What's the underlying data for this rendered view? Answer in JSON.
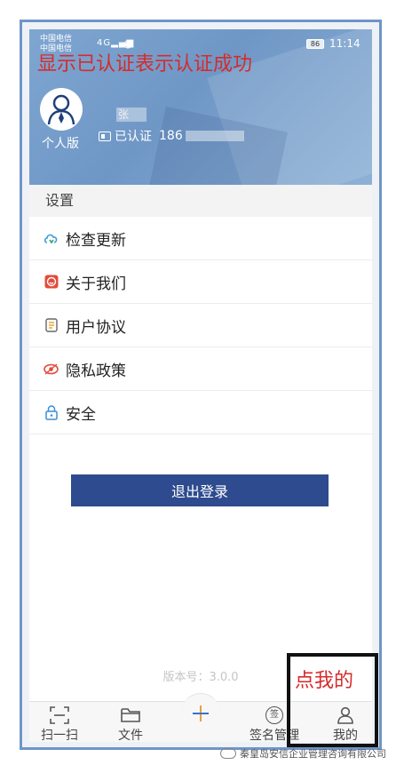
{
  "status_bar": {
    "carrier_1": "中国电信",
    "carrier_2": "中国电信",
    "network": "4G",
    "battery": "86",
    "time": "11:14"
  },
  "profile": {
    "avatar_caption": "个人版",
    "username": "张",
    "verified_label": "已认证",
    "phone": "186",
    "annotation": "显示已认证表示认证成功"
  },
  "settings": {
    "title": "设置",
    "items": [
      {
        "label": "检查更新",
        "icon": "cloud-refresh-icon"
      },
      {
        "label": "关于我们",
        "icon": "smile-badge-icon"
      },
      {
        "label": "用户协议",
        "icon": "document-icon"
      },
      {
        "label": "隐私政策",
        "icon": "shield-eye-icon"
      },
      {
        "label": "安全",
        "icon": "lock-icon"
      }
    ]
  },
  "logout_label": "退出登录",
  "version": "版本号：3.0.0",
  "tabbar": {
    "scan": "扫一扫",
    "files": "文件",
    "signature": "签名管理",
    "signature_glyph": "签",
    "mine": "我的"
  },
  "bottom_annotation": "点我的",
  "watermark": "秦皇岛安信企业管理咨询有限公司",
  "colors": {
    "header": "#7fa6d1",
    "button": "#2d4b8e",
    "annotation": "#d62b2b"
  }
}
